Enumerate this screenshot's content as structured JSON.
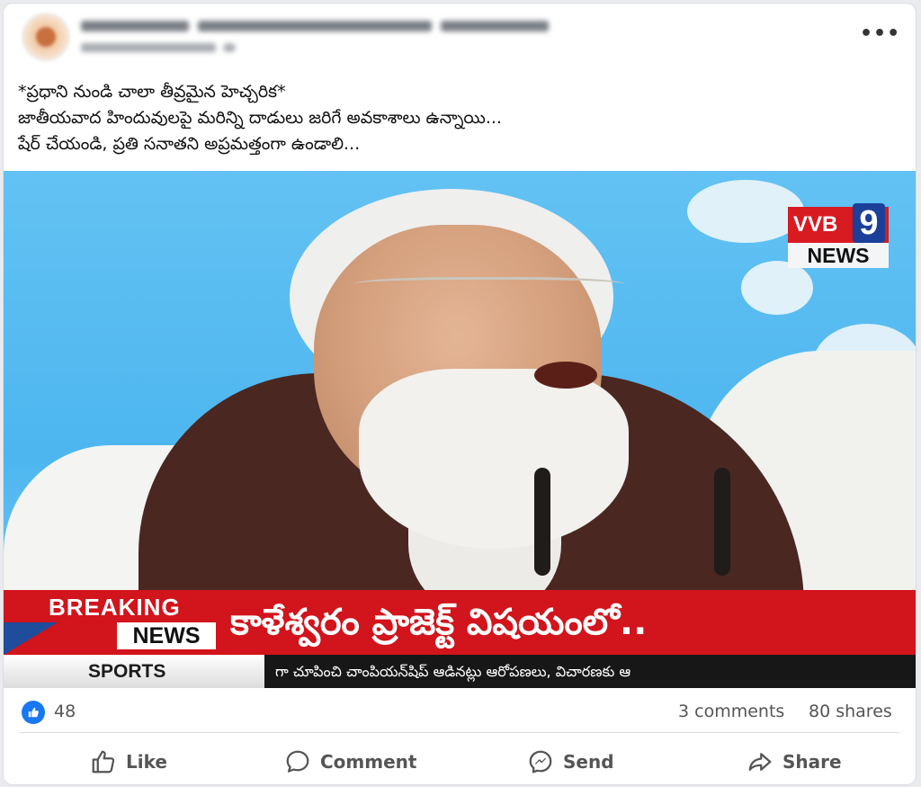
{
  "post": {
    "text": "*ప్రధాని నుండి చాలా తీవ్రమైన హెచ్చరిక*\nజాతీయవాద హిందువులపై మరిన్ని దాడులు జరిగే అవకాశాలు ఉన్నాయి...\nషేర్ చేయండి, ప్రతి సనాతని అప్రమత్తంగా ఉండాలి...",
    "more_label": "•••"
  },
  "video": {
    "logo_top": "VVB",
    "logo_number": "9",
    "logo_bottom": "NEWS",
    "breaking_label": "BREAKING",
    "news_label": "NEWS",
    "headline": "కాళేశ్వరం ప్రాజెక్ట్ విషయంలో..",
    "sports_label": "SPORTS",
    "ticker_text": "గా చూపించి చాంపియన్‌షిప్  ఆడినట్లు ఆరోపణలు, విచారణకు ఆ"
  },
  "stats": {
    "reactions_count": "48",
    "comments": "3 comments",
    "shares": "80 shares"
  },
  "actions": {
    "like": "Like",
    "comment": "Comment",
    "send": "Send",
    "share": "Share"
  },
  "colors": {
    "facebook_blue": "#1877f2",
    "breaking_red": "#d2141c",
    "logo_blue": "#1c3f9a"
  }
}
